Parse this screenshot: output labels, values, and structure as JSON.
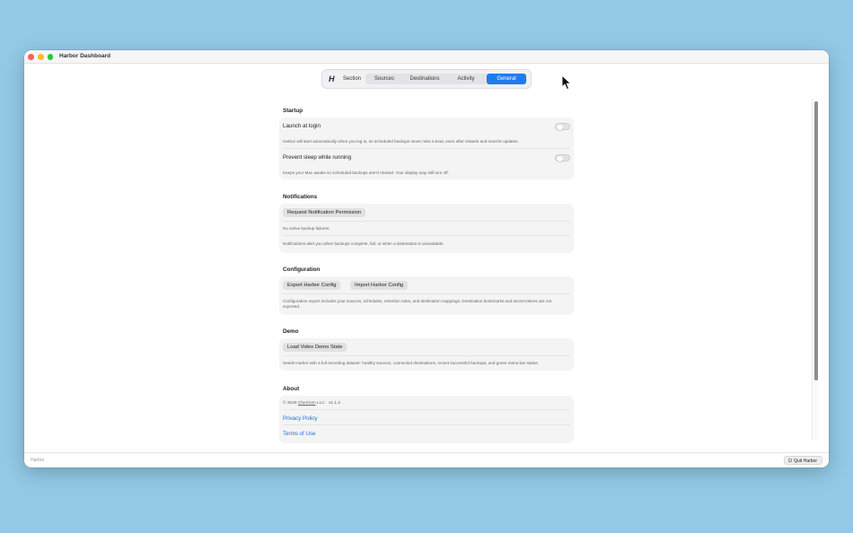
{
  "window": {
    "title": "Harbor Dashboard"
  },
  "nav": {
    "logo": "H",
    "section_label": "Section",
    "tabs": [
      {
        "label": "Sources"
      },
      {
        "label": "Destinations"
      },
      {
        "label": "Activity"
      },
      {
        "label": "General"
      }
    ],
    "active_tab": "General",
    "accent_color": "#1f7cf0"
  },
  "startup": {
    "title": "Startup",
    "launch_label": "Launch at login",
    "launch_enabled": false,
    "launch_note": "Harbor will start automatically when you log in, so scheduled backups never miss a beat, even after restarts and macOS updates.",
    "sleep_label": "Prevent sleep while running",
    "sleep_enabled": false,
    "sleep_note": "Keeps your Mac awake so scheduled backups aren't missed. Your display may still turn off."
  },
  "notifications": {
    "title": "Notifications",
    "request_button": "Request Notification Permission",
    "status": "No active backup failures.",
    "note": "Notifications alert you when backups complete, fail, or when a destination is unavailable."
  },
  "configuration": {
    "title": "Configuration",
    "export_button": "Export Harbor Config",
    "import_button": "Import Harbor Config",
    "note": "Configuration export includes your sources, schedules, retention rules, and destination mappings. Destination bookmarks and secret tokens are not exported."
  },
  "demo": {
    "title": "Demo",
    "load_button": "Load Video Demo State",
    "note": "Seeds Harbor with a full recording dataset: healthy sources, connected destinations, recent successful backups, and green menu bar status."
  },
  "about": {
    "title": "About",
    "copyright_prefix": "© 2026",
    "company": "Cherrium",
    "copyright_suffix": "LLC · v1.1.2",
    "privacy_link": "Privacy Policy",
    "terms_link": "Terms of Use"
  },
  "footer": {
    "app_label": "Harbor",
    "quit_button": "Quit Harbor"
  }
}
